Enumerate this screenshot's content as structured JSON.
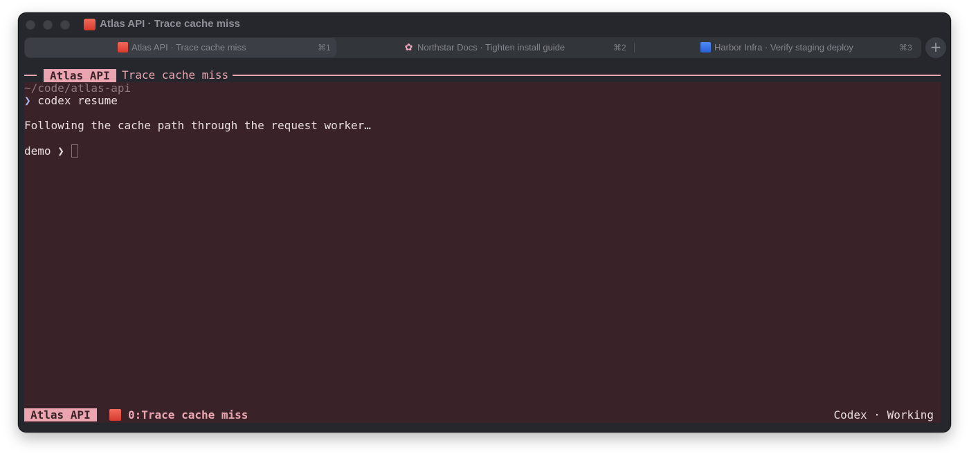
{
  "window": {
    "title": "Atlas API · Trace cache miss"
  },
  "tabs": [
    {
      "label": "Atlas API · Trace cache miss",
      "shortcut": "⌘1",
      "icon": "red-square-icon",
      "active": true
    },
    {
      "label": "Northstar Docs · Tighten install guide",
      "shortcut": "⌘2",
      "icon": "cherry-blossom-icon",
      "active": false
    },
    {
      "label": "Harbor Infra · Verify staging deploy",
      "shortcut": "⌘3",
      "icon": "blue-square-icon",
      "active": false
    }
  ],
  "new_tab_label": "+",
  "pane": {
    "session_label": "Atlas API",
    "title": "Trace cache miss"
  },
  "terminal": {
    "cwd": "~/code/atlas-api",
    "prompt_symbol": "❯",
    "command": "codex resume",
    "output": "Following the cache path through the request worker…",
    "prompt_name": "demo"
  },
  "statusbar": {
    "session": "Atlas API",
    "window": "0:Trace cache miss",
    "right": "Codex · Working"
  },
  "colors": {
    "accent_pink": "#eaa5b0",
    "terminal_bg": "#3a2328",
    "chrome_bg": "#25272c"
  }
}
